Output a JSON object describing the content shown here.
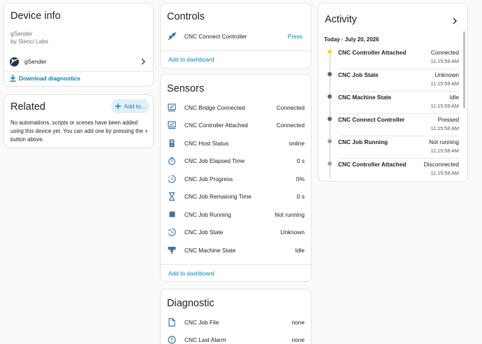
{
  "device_info": {
    "title": "Device info",
    "model": "gSender",
    "manufacturer": "by Sienci Labs",
    "integration_name": "gSender",
    "download_label": "Download diagnostics"
  },
  "related": {
    "title": "Related",
    "add_label": "Add to...",
    "empty_text": "No automations, scripts or scenes have been added using this device yet. You can add one by pressing the + button above."
  },
  "controls": {
    "title": "Controls",
    "items": [
      {
        "name": "CNC Connect Controller",
        "action": "Press",
        "icon": "connection-icon"
      }
    ],
    "add_to_dashboard": "Add to dashboard"
  },
  "sensors": {
    "title": "Sensors",
    "items": [
      {
        "name": "CNC Bridge Connected",
        "value": "Connected",
        "icon": "monitor-check-icon"
      },
      {
        "name": "CNC Controller Attached",
        "value": "Connected",
        "icon": "monitor-check-icon"
      },
      {
        "name": "CNC Host Status",
        "value": "online",
        "icon": "server-icon"
      },
      {
        "name": "CNC Job Elapsed Time",
        "value": "0 s",
        "icon": "timer-icon"
      },
      {
        "name": "CNC Job Progress",
        "value": "0%",
        "icon": "progress-clock-icon"
      },
      {
        "name": "CNC Job Remaining Time",
        "value": "0 s",
        "icon": "hourglass-icon"
      },
      {
        "name": "CNC Job Running",
        "value": "Not running",
        "icon": "stop-icon"
      },
      {
        "name": "CNC Job State",
        "value": "Unknown",
        "icon": "state-icon"
      },
      {
        "name": "CNC Machine State",
        "value": "Idle",
        "icon": "machine-icon"
      }
    ],
    "add_to_dashboard": "Add to dashboard"
  },
  "diagnostic": {
    "title": "Diagnostic",
    "items": [
      {
        "name": "CNC Job File",
        "value": "none",
        "icon": "file-icon"
      },
      {
        "name": "CNC Last Alarm",
        "value": "none",
        "icon": "alert-circle-icon"
      }
    ]
  },
  "activity": {
    "title": "Activity",
    "date_header": "Today · July 20, 2026",
    "items": [
      {
        "name": "CNC Controller Attached",
        "state": "Connected",
        "time": "11:15:59 AM",
        "dot_color": "#fdd835"
      },
      {
        "name": "CNC Job State",
        "state": "Unknown",
        "time": "11:15:59 AM",
        "dot_color": "#616161"
      },
      {
        "name": "CNC Machine State",
        "state": "Idle",
        "time": "11:15:59 AM",
        "dot_color": "#616161"
      },
      {
        "name": "CNC Connect Controller",
        "state": "Pressed",
        "time": "11:15:58 AM",
        "dot_color": "#616161"
      },
      {
        "name": "CNC Job Running",
        "state": "Not running",
        "time": "11:15:58 AM",
        "dot_color": "#9e9e9e"
      },
      {
        "name": "CNC Controller Attached",
        "state": "Disconnected",
        "time": "11:15:58 AM",
        "dot_color": "#9e9e9e"
      }
    ]
  },
  "colors": {
    "accent": "#0b82b8",
    "icon": "#44739e",
    "chip_bg": "#e1f1f8"
  }
}
